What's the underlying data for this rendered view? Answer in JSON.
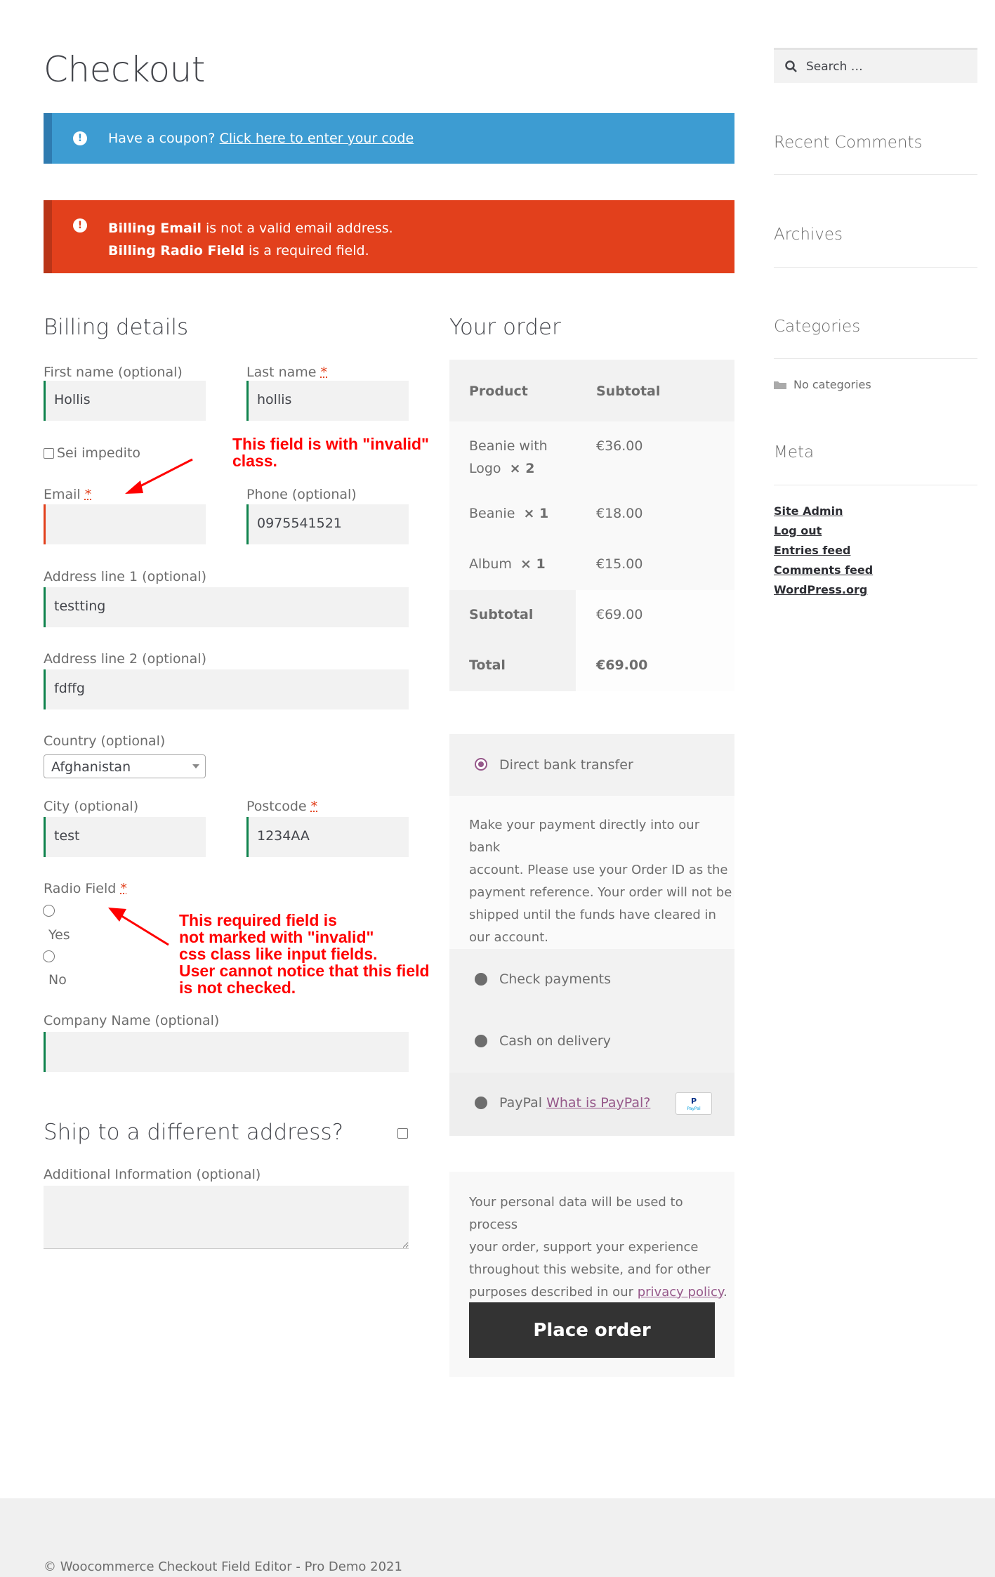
{
  "page": {
    "title": "Checkout"
  },
  "notices": {
    "coupon_text": "Have a coupon?",
    "coupon_link": "Click here to enter your code",
    "error_line1_bold": "Billing Email",
    "error_line1_rest": " is not a valid email address.",
    "error_line2_bold": "Billing Radio Field",
    "error_line2_rest": " is a required field."
  },
  "billing": {
    "heading": "Billing details",
    "first_name_label": "First name (optional)",
    "first_name_value": "Hollis",
    "last_name_label": "Last name",
    "last_name_value": "hollis",
    "checkbox_label": "Sei impedito",
    "email_label": "Email",
    "email_value": "",
    "phone_label": "Phone (optional)",
    "phone_value": "0975541521",
    "address1_label": "Address line 1 (optional)",
    "address1_value": "testting",
    "address2_label": "Address line 2 (optional)",
    "address2_value": "fdffg",
    "country_label": "Country (optional)",
    "country_value": "Afghanistan",
    "city_label": "City (optional)",
    "city_value": "test",
    "postcode_label": "Postcode",
    "postcode_value": "1234AA",
    "radio_label": "Radio Field",
    "radio_yes": "Yes",
    "radio_no": "No",
    "company_label": "Company Name  (optional)",
    "company_value": "",
    "required_mark": "*"
  },
  "shipping": {
    "heading": "Ship to a different address?",
    "additional_label": "Additional Information (optional)"
  },
  "annotations": {
    "email_note": [
      "This field is with \"invalid\"",
      "class."
    ],
    "radio_note": [
      "This required field is",
      "not marked with \"invalid\"",
      "css class like input fields.",
      "User cannot notice that this field",
      "is not checked."
    ]
  },
  "order": {
    "heading": "Your order",
    "col_product": "Product",
    "col_subtotal": "Subtotal",
    "items": [
      {
        "name_line1": "Beanie with",
        "name_line2": "Logo",
        "qty": "× 2",
        "price": "€36.00"
      },
      {
        "name_line1": "Beanie",
        "qty": "× 1",
        "price": "€18.00"
      },
      {
        "name_line1": "Album",
        "qty": "× 1",
        "price": "€15.00"
      }
    ],
    "subtotal_label": "Subtotal",
    "subtotal_value": "€69.00",
    "total_label": "Total",
    "total_value": "€69.00"
  },
  "payment": {
    "bank_transfer": "Direct bank transfer",
    "bank_desc": [
      "Make your payment directly into our bank",
      "account. Please use your Order ID as the",
      "payment reference. Your order will not be",
      "shipped until the funds have cleared in",
      "our account."
    ],
    "check": "Check payments",
    "cod": "Cash on delivery",
    "paypal": "PayPal",
    "paypal_link": "What is PayPal?",
    "paypal_logo_text": "PayPal",
    "privacy_lines": [
      "Your personal data will be used to process",
      "your order, support your experience",
      "throughout this website, and for other"
    ],
    "privacy_last_prefix": "purposes described in our ",
    "privacy_link": "privacy policy",
    "privacy_last_suffix": ".",
    "place_order": "Place order"
  },
  "sidebar": {
    "search_placeholder": "Search …",
    "recent_comments": "Recent Comments",
    "archives": "Archives",
    "categories": "Categories",
    "no_categories": "No categories",
    "meta": "Meta",
    "meta_links": [
      "Site Admin",
      "Log out",
      "Entries feed",
      "Comments feed",
      "WordPress.org"
    ]
  },
  "footer": {
    "text": "© Woocommerce Checkout Field Editor - Pro Demo 2021"
  },
  "colors": {
    "info": "#3d9cd2",
    "error": "#e2401c",
    "valid": "#0f834d",
    "accent": "#96588a",
    "button": "#333333"
  }
}
